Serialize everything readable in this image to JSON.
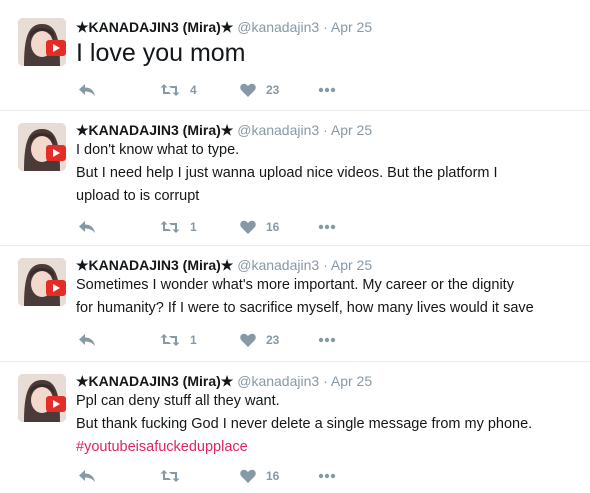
{
  "tweets": [
    {
      "fullname": "★KANADAJIN3 (Mira)★",
      "handle": "@kanadajin3",
      "time": "Apr 25",
      "lines": [
        "I love you mom"
      ],
      "retweets": "4",
      "likes": "23"
    },
    {
      "fullname": "★KANADAJIN3 (Mira)★",
      "handle": "@kanadajin3",
      "time": "Apr 25",
      "lines": [
        "I don't know what to type.",
        "But I need help I just wanna upload nice videos. But the platform I",
        "upload to is corrupt"
      ],
      "retweets": "1",
      "likes": "16"
    },
    {
      "fullname": "★KANADAJIN3 (Mira)★",
      "handle": "@kanadajin3",
      "time": "Apr 25",
      "lines": [
        "Sometimes I wonder what's more important. My career or the dignity",
        "for humanity? If I were to sacrifice myself, how many lives would it save"
      ],
      "retweets": "1",
      "likes": "23"
    },
    {
      "fullname": "★KANADAJIN3 (Mira)★",
      "handle": "@kanadajin3",
      "time": "Apr 25",
      "lines": [
        "Ppl can deny stuff all they want.",
        "But thank fucking God I never delete a single message from my phone."
      ],
      "hashtag": "#youtubeisafuckedupplace",
      "retweets": "",
      "likes": "16"
    }
  ],
  "separator": "·",
  "colors": {
    "hashtag": "#e0245e",
    "muted": "#8899a6",
    "divider": "#e6ecf0",
    "avatar_play": "#e52d27"
  },
  "icons": [
    "reply-icon",
    "retweet-icon",
    "like-icon",
    "more-icon"
  ]
}
